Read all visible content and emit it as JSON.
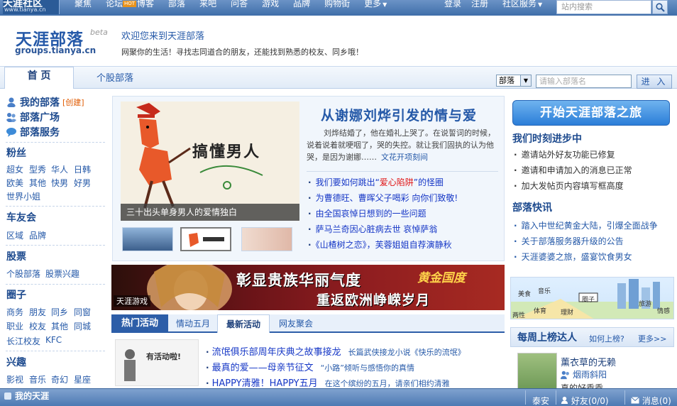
{
  "topbar": {
    "logo_main": "天涯社区",
    "logo_sub": "www.tianya.cn",
    "nav": [
      "聚焦",
      "论坛",
      "博客",
      "部落",
      "来吧",
      "问答",
      "游戏",
      "品牌",
      "购物街",
      "更多"
    ],
    "hot_badge": "HOT",
    "login": "登录",
    "register": "注册",
    "community_service": "社区服务",
    "search_placeholder": "站内搜索"
  },
  "header": {
    "brand": "天涯部落",
    "beta": "beta",
    "url": "groups.tianya.cn",
    "welcome": "欢迎您来到天涯部落",
    "slogan": "网聚你的生活！寻找志同道合的朋友，还能找到熟悉的校友、同乡哦！"
  },
  "tabs": {
    "home": "首 页",
    "stock": "个股部落",
    "select_value": "部落",
    "input_placeholder": "请输入部落名",
    "enter": "进 入"
  },
  "sidebar": {
    "my_tribe": "我的部落",
    "create": "[创建]",
    "plaza": "部落广场",
    "service": "部落服务",
    "fans": {
      "title": "粉丝",
      "links": [
        "超女",
        "型秀",
        "华人",
        "日韩",
        "欧美",
        "其他",
        "快男",
        "好男",
        "世界小姐"
      ]
    },
    "cars": {
      "title": "车友会",
      "links": [
        "区域",
        "品牌"
      ]
    },
    "stocks": {
      "title": "股票",
      "links": [
        "个股部落",
        "股票兴趣"
      ]
    },
    "circle": {
      "title": "圈子",
      "links": [
        "商务",
        "朋友",
        "同乡",
        "同窗",
        "职业",
        "校友",
        "其他",
        "同城",
        "长江校友",
        "KFC"
      ]
    },
    "interest": {
      "title": "兴趣",
      "links": [
        "影视",
        "音乐",
        "奇幻",
        "星座"
      ]
    }
  },
  "feature": {
    "image_title": "搞懂男人",
    "caption": "三十出头单身男人的爱情独白",
    "headline": "从谢娜刘烨引发的情与爱",
    "text": "刘烨结婚了，他在婚礼上哭了。在说誓词的时候，说着说着就哽咽了，哭的失控。就让我们固执的认为他哭，是因为谢娜……",
    "text_more": "文花开项刻间",
    "items": [
      {
        "text": "我们要如何跳出“",
        "em": "爱心陷阱",
        "tail": "”的怪圈"
      },
      {
        "text": "为曹德旺、曹晖父子喝彩 向你们致敬!",
        "em": "",
        "tail": ""
      },
      {
        "text": "由全国哀悼日想到的一些问题",
        "em": "",
        "tail": ""
      },
      {
        "text": "萨马兰奇因心脏病去世 哀悼萨翁",
        "em": "",
        "tail": ""
      },
      {
        "text": "《山楂树之恋》，芙蓉姐姐自荐演静秋",
        "em": "",
        "tail": ""
      }
    ]
  },
  "banner": {
    "line1": "彰显贵族华丽气度",
    "line2": "重返欧洲峥嵘岁月",
    "logo": "黄金国度",
    "game": "天涯游戏"
  },
  "activity": {
    "tabs": [
      "热门活动",
      "情动五月",
      "最新活动",
      "网友聚会"
    ],
    "image_text": "有活动啦!",
    "items": [
      {
        "a": "流氓俱乐部周年庆典之故事接龙",
        "b": "长篇武侠接龙小说《快乐的流氓》"
      },
      {
        "a": "最真的爱——母亲节征文",
        "b": "“小路”倾听与感悟你的真情"
      },
      {
        "a": "HAPPY清雅！HAPPY五月",
        "b": "在这个缤纷的五月，请亲们相约清雅"
      }
    ]
  },
  "right": {
    "start": "开始天涯部落之旅",
    "progress_title": "我们时刻进步中",
    "progress_items": [
      "邀请站外好友功能已修复",
      "邀请和申请加入的消息已正常",
      "加大发帖页内容填写框高度"
    ],
    "news_title": "部落快讯",
    "news_items": [
      "踏入中世纪黄金大陆，引爆全面战争",
      "关于部落服务器升级的公告",
      "天涯婆婆之旅，盛宴饮食男女"
    ],
    "map_labels": [
      "美食",
      "音乐",
      "两性",
      "体育",
      "理财",
      "圈子",
      "旅游",
      "情感"
    ],
    "weekly_title": "每周上榜达人",
    "weekly_how": "如何上榜?",
    "weekly_more": "更多>>",
    "weekly_name": "薰衣草的无赖",
    "weekly_sub": "烟雨斜阳",
    "weekly_line3": "真的好乖乖"
  },
  "bottombar": {
    "mine": "我的天涯",
    "taian": "泰安",
    "friends": "好友(0/0)",
    "messages": "消息(0)"
  }
}
